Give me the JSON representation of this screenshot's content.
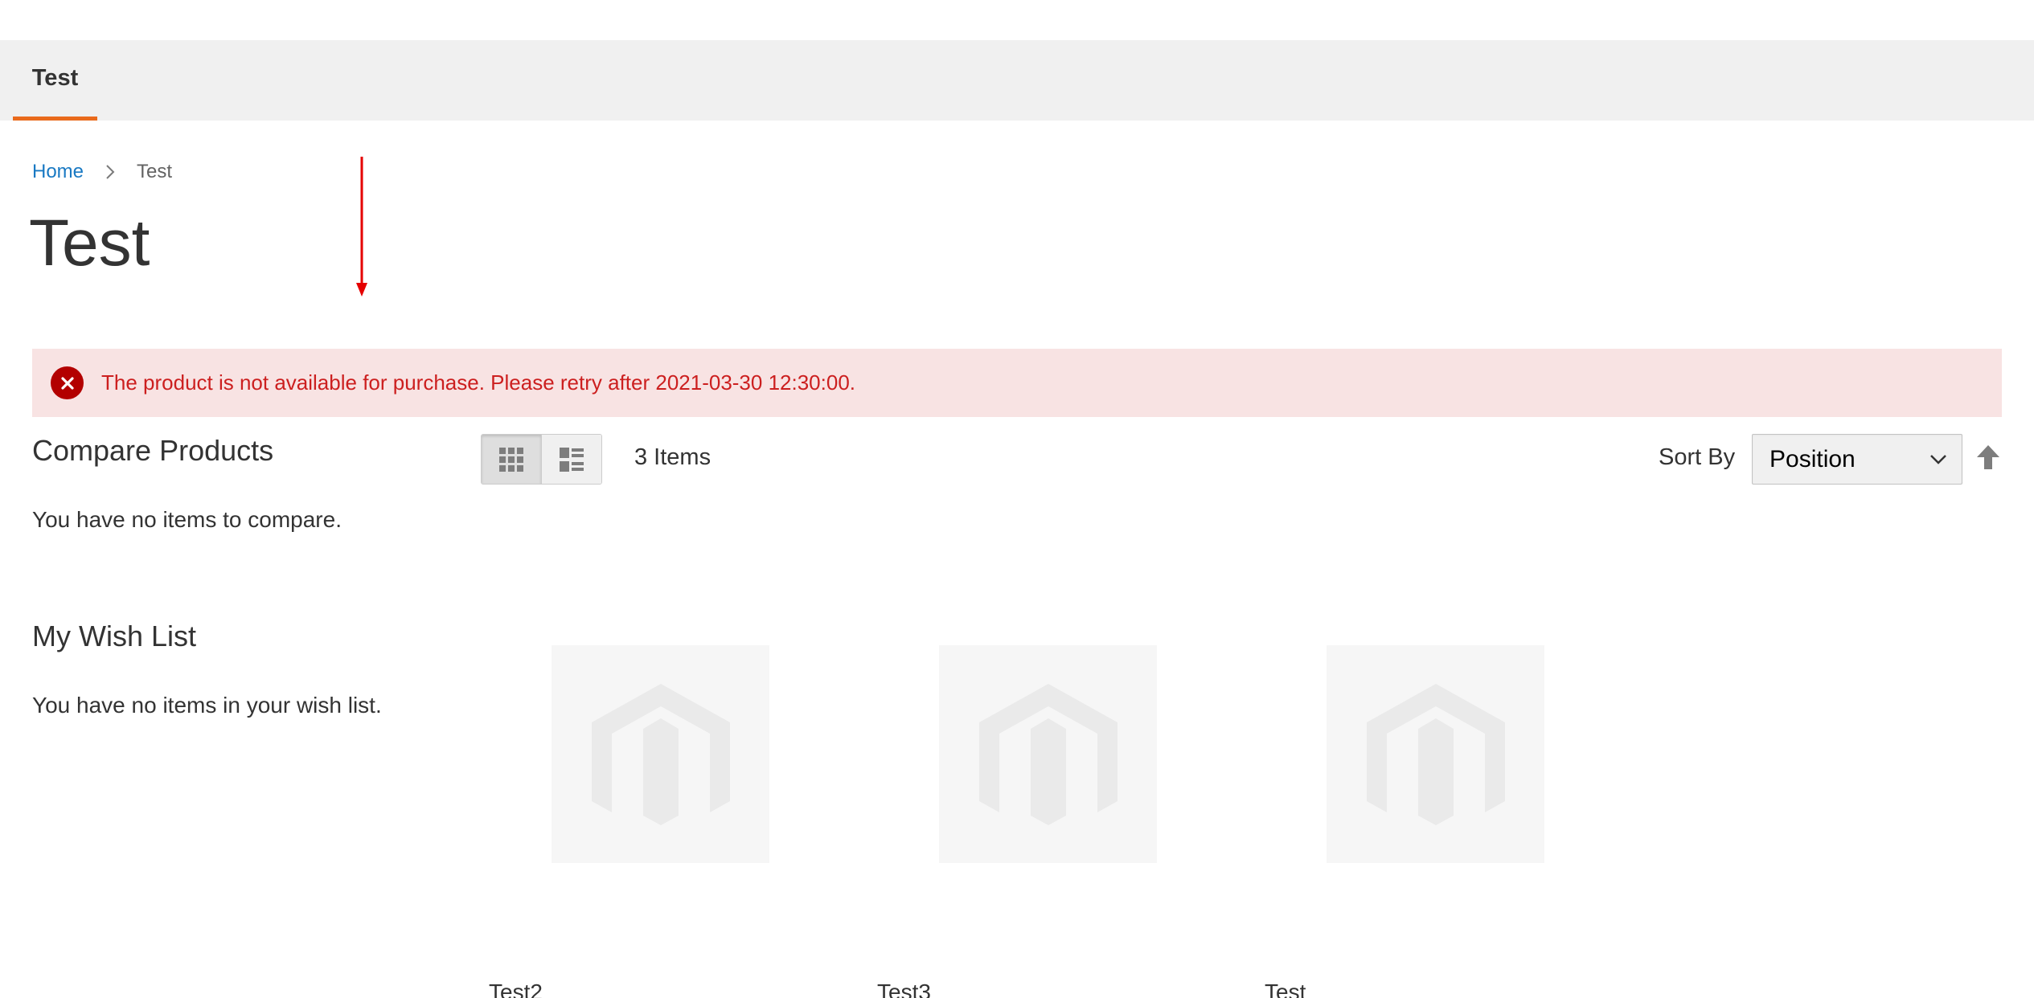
{
  "nav": {
    "items": [
      {
        "label": "Test"
      }
    ]
  },
  "breadcrumb": {
    "home": "Home",
    "current": "Test"
  },
  "page": {
    "title": "Test"
  },
  "message": {
    "error_text": "The product is not available for purchase. Please retry after 2021-03-30 12:30:00."
  },
  "sidebar": {
    "compare": {
      "title": "Compare Products",
      "empty": "You have no items to compare."
    },
    "wishlist": {
      "title": "My Wish List",
      "empty": "You have no items in your wish list."
    }
  },
  "toolbar": {
    "view_modes": [
      {
        "name": "grid-icon",
        "active": true
      },
      {
        "name": "list-icon",
        "active": false
      }
    ],
    "amount": "3 Items",
    "sort_label": "Sort By",
    "sort_selected": "Position",
    "sort_direction_icon": "arrow-up-icon"
  },
  "products": [
    {
      "name": "Test2"
    },
    {
      "name": "Test3"
    },
    {
      "name": "Test"
    }
  ],
  "colors": {
    "accent": "#e96a1c",
    "link": "#1979c3",
    "error_bg": "#f8e3e3",
    "error_text": "#cc1f1f",
    "annotation": "#e50000"
  }
}
